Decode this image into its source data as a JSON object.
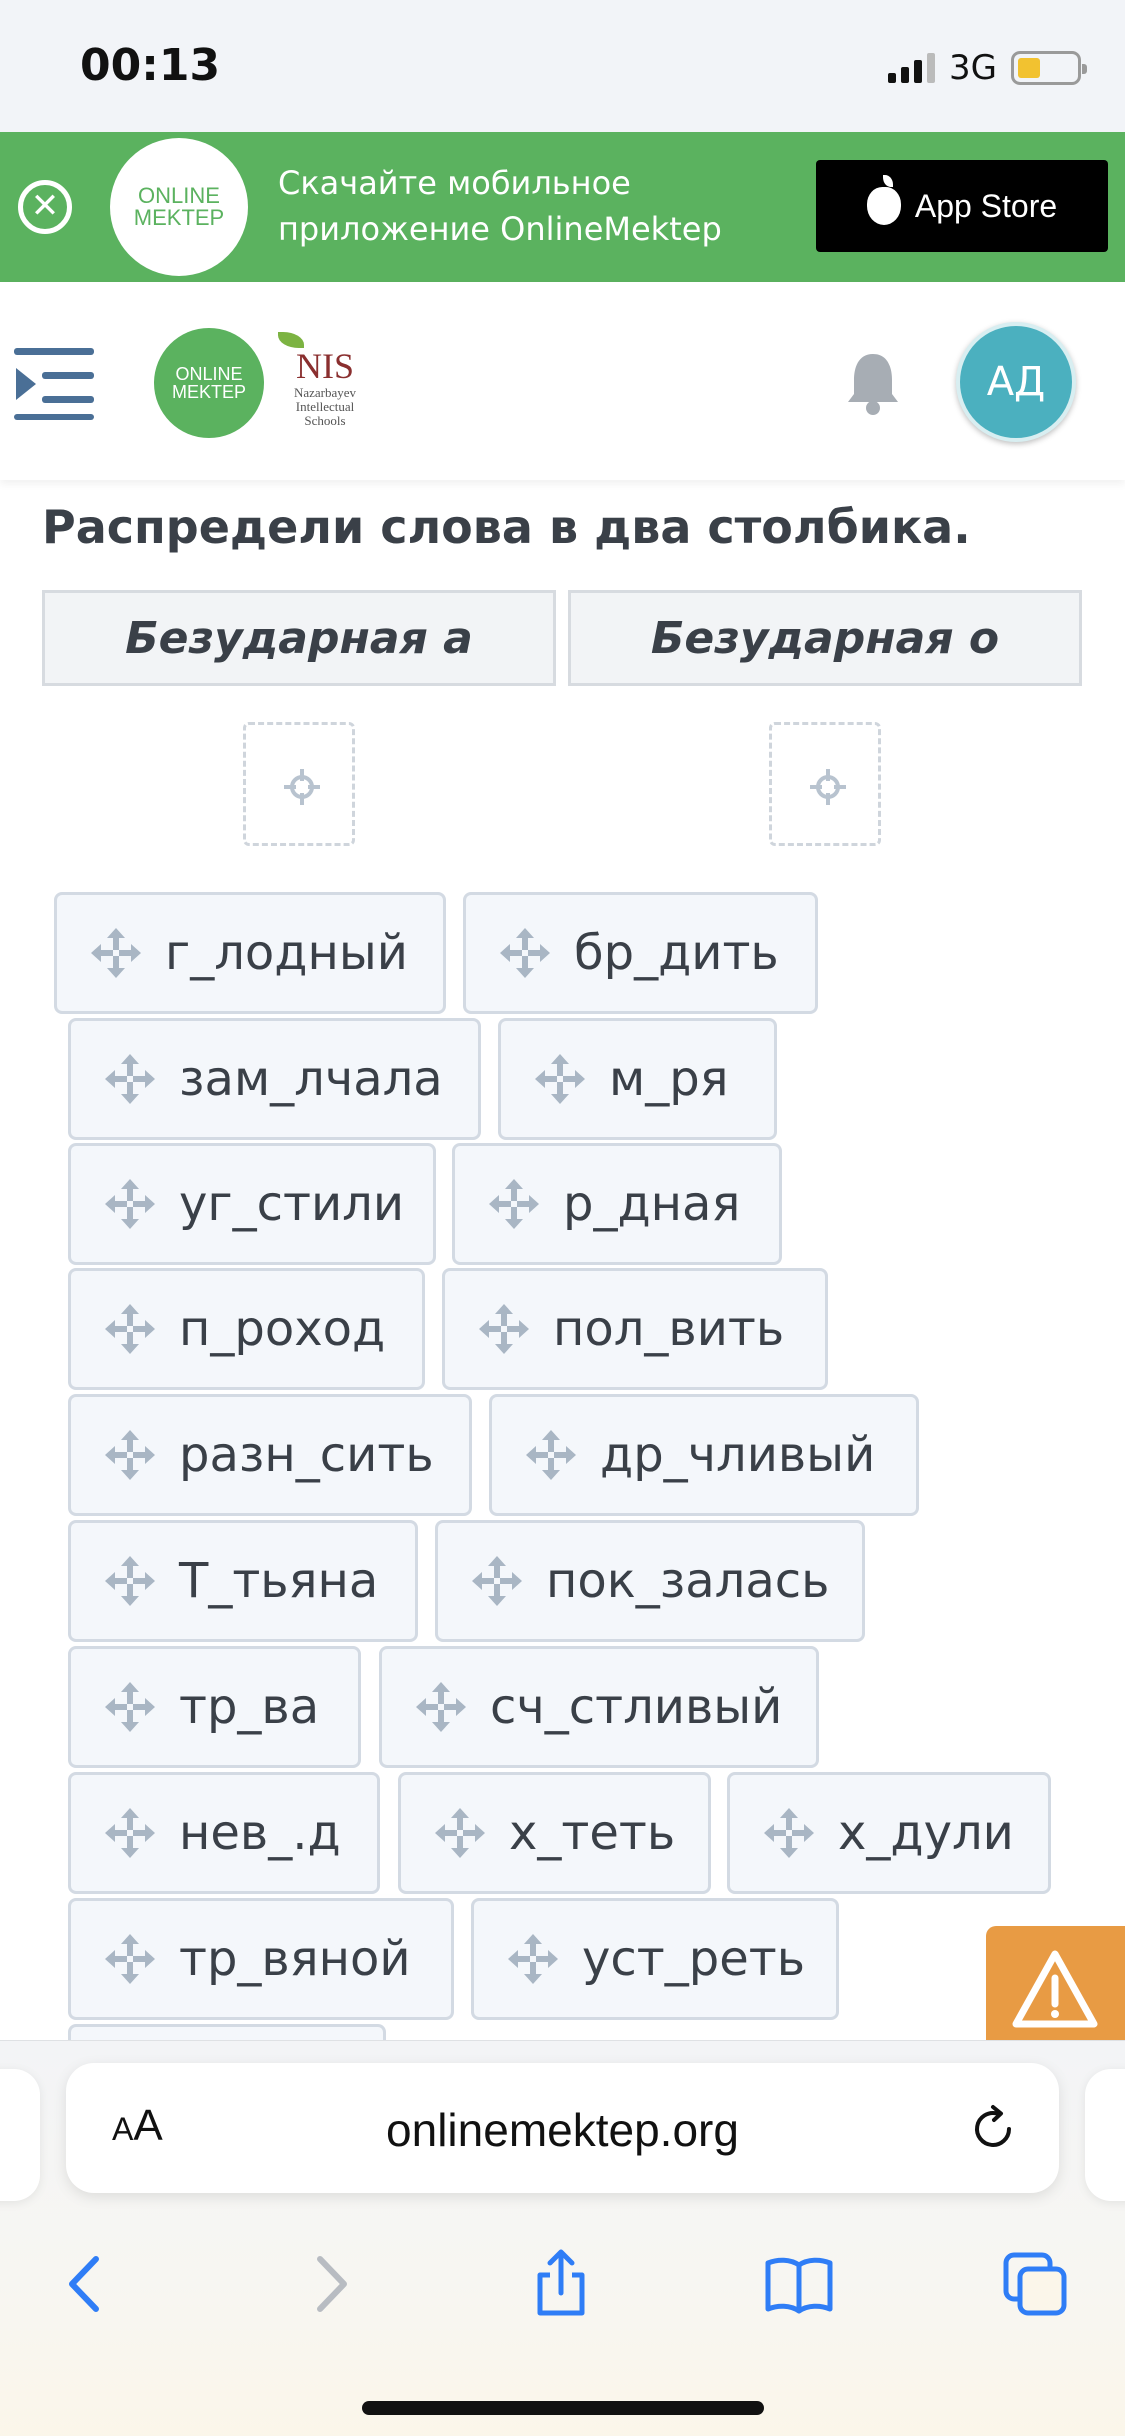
{
  "status_bar": {
    "time": "00:13",
    "network": "3G",
    "battery_level": 0.3
  },
  "promo_banner": {
    "logo_line1": "ONLINE",
    "logo_line2": "MEKTEP",
    "text_line1": "Скачайте мобильное",
    "text_line2": "приложение OnlineMektep",
    "store_label": "App Store",
    "close_icon": "close-circle-icon"
  },
  "header": {
    "logo_line1": "ONLINE",
    "logo_line2": "MEKTEP",
    "nis_title": "NIS",
    "nis_sub1": "Nazarbayev",
    "nis_sub2": "Intellectual",
    "nis_sub3": "Schools",
    "avatar_initials": "АД",
    "icons": [
      "menu-icon",
      "bell-icon"
    ]
  },
  "task": {
    "title": "Распредели слова в два столбика.",
    "columns": [
      "Безударная а",
      "Безударная о"
    ],
    "words": [
      "г_лодный",
      "бр_дить",
      "зам_лчала",
      "м_ря",
      "уг_стили",
      "р_дная",
      "п_роход",
      "пол_вить",
      "разн_сить",
      "др_чливый",
      "Т_тьяна",
      "пок_залась",
      "тр_ва",
      "сч_стливый",
      "нев_.д",
      "х_теть",
      "х_дули",
      "тр_вяной",
      "уст_реть"
    ]
  },
  "browser": {
    "url": "onlinemektep.org",
    "aa_small": "A",
    "aa_big": "A",
    "toolbar_icons": [
      "back-icon",
      "forward-icon",
      "share-icon",
      "bookmarks-icon",
      "tabs-icon"
    ]
  },
  "colors": {
    "brand_green": "#5bb25f",
    "avatar_teal": "#4bb0bf",
    "warning_orange": "#e89b44",
    "safari_blue": "#2f7df6"
  }
}
